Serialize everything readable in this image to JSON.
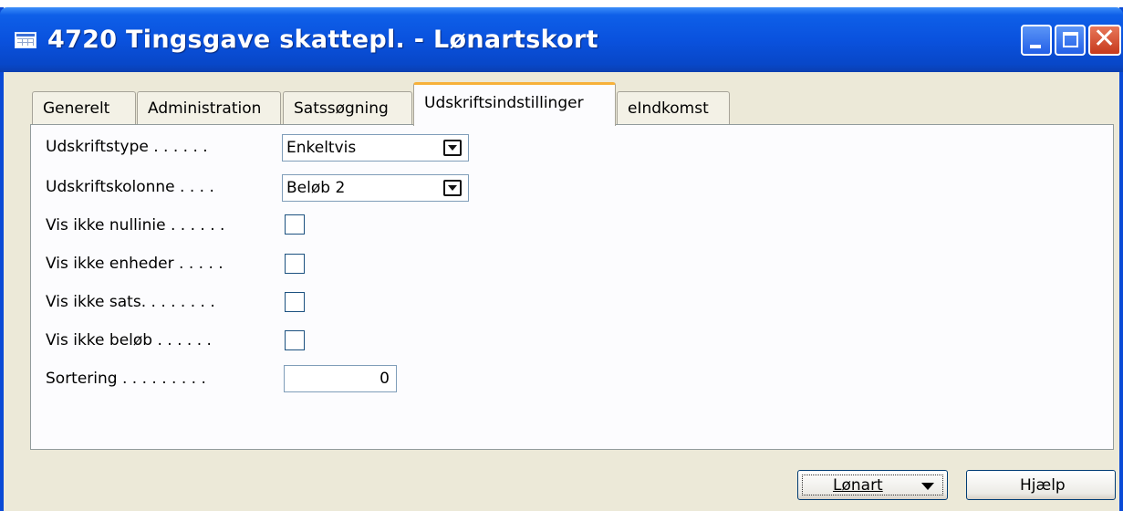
{
  "window": {
    "title": "4720 Tingsgave skattepl. - Lønartskort"
  },
  "tabs": [
    {
      "label": "Generelt",
      "active": false
    },
    {
      "label": "Administration",
      "active": false
    },
    {
      "label": "Satssøgning",
      "active": false
    },
    {
      "label": "Udskriftsindstillinger",
      "active": true
    },
    {
      "label": "eIndkomst",
      "active": false
    }
  ],
  "form": {
    "udskriftstype": {
      "label": "Udskriftstype . . . . . .",
      "value": "Enkeltvis"
    },
    "udskriftskolonne": {
      "label": "Udskriftskolonne . . . .",
      "value": "Beløb 2"
    },
    "vis_ikke_nullinie": {
      "label": "Vis ikke nullinie . . . . . .",
      "checked": false
    },
    "vis_ikke_enheder": {
      "label": "Vis ikke enheder . . . . .",
      "checked": false
    },
    "vis_ikke_sats": {
      "label": "Vis ikke sats. . . . . . . .",
      "checked": false
    },
    "vis_ikke_beloeb": {
      "label": "Vis ikke beløb . . . . . .",
      "checked": false
    },
    "sortering": {
      "label": "Sortering . . . . . . . . .",
      "value": "0"
    }
  },
  "buttons": {
    "loenart": "Lønart",
    "hjaelp": "Hjælp"
  },
  "colors": {
    "titlebar": "#0a52de",
    "active_tab_accent": "#f7b13a",
    "dialog_bg": "#ece9d8"
  },
  "icons": {
    "window": "table-icon",
    "minimize": "minimize-icon",
    "maximize": "maximize-icon",
    "close": "close-icon",
    "dropdown": "chevron-down-icon"
  }
}
